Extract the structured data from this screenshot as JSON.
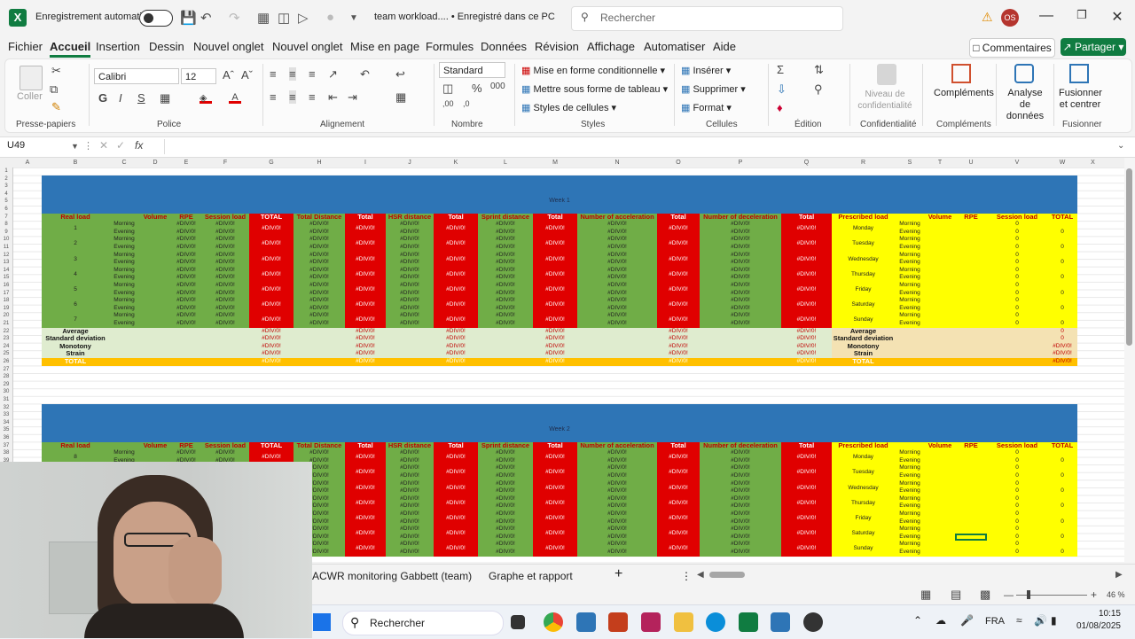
{
  "titlebar": {
    "autosave_label": "Enregistrement automatique",
    "doc_title": "team workload.... • Enregistré dans ce PC",
    "search_placeholder": "Rechercher",
    "avatar_initials": "OS"
  },
  "menu": [
    "Fichier",
    "Accueil",
    "Insertion",
    "Dessin",
    "Nouvel onglet",
    "Nouvel onglet",
    "Mise en page",
    "Formules",
    "Données",
    "Révision",
    "Affichage",
    "Automatiser",
    "Aide"
  ],
  "comments_label": "Commentaires",
  "share_label": "Partager",
  "ribbon": {
    "paste_label": "Coller",
    "clipboard_label": "Presse-papiers",
    "font_name": "Calibri",
    "font_size": "12",
    "font_label": "Police",
    "alignment_label": "Alignement",
    "number_format": "Standard",
    "number_label": "Nombre",
    "cond_format": "Mise en forme conditionnelle",
    "table_format": "Mettre sous forme de tableau",
    "cell_styles": "Styles de cellules",
    "styles_label": "Styles",
    "insert": "Insérer",
    "delete": "Supprimer",
    "format": "Format",
    "cells_label": "Cellules",
    "edit_label": "Édition",
    "sensitivity": "Niveau de confidentialité",
    "sensitivity_group": "Confidentialité",
    "addins": "Compléments",
    "addins_group": "Compléments",
    "analyze": "Analyse de données",
    "merge": "Fusionner et centrer",
    "merge_group": "Fusionner"
  },
  "formula_bar": {
    "name_box": "U49"
  },
  "columns": [
    "A",
    "B",
    "C",
    "D",
    "E",
    "F",
    "G",
    "H",
    "I",
    "J",
    "K",
    "L",
    "M",
    "N",
    "O",
    "P",
    "Q",
    "R",
    "S",
    "T",
    "U",
    "V",
    "W",
    "X"
  ],
  "sheet": {
    "week1": "Week 1",
    "week2": "Week 2",
    "headers": [
      "Real load",
      "",
      "Volume",
      "RPE",
      "Session load",
      "TOTAL",
      "Total Distance",
      "Total",
      "HSR distance",
      "Total",
      "Sprint distance",
      "Total",
      "Number of acceleration",
      "Total",
      "Number of deceleration",
      "Total",
      "Prescribed load",
      "",
      "Volume",
      "RPE",
      "Session load",
      "TOTAL"
    ],
    "days": [
      "1",
      "2",
      "3",
      "4",
      "5",
      "6",
      "7"
    ],
    "week2_first_day": "8",
    "periods": [
      "Morning",
      "Evening"
    ],
    "weekdays": [
      "Monday",
      "Tuesday",
      "Wednesday",
      "Thursday",
      "Friday",
      "Saturday",
      "Sunday"
    ],
    "error": "#DIV/0!",
    "zero": "0",
    "stats": [
      "Average",
      "Standard deviation",
      "Monotony",
      "Strain",
      "TOTAL"
    ]
  },
  "sheet_tabs": [
    "ACWR monitoring Gabbett (team)",
    "Graphe et rapport"
  ],
  "status": {
    "zoom": "46 %"
  },
  "taskbar": {
    "search": "Rechercher",
    "lang": "FRA",
    "time": "10:15",
    "date": "01/08/2025"
  }
}
